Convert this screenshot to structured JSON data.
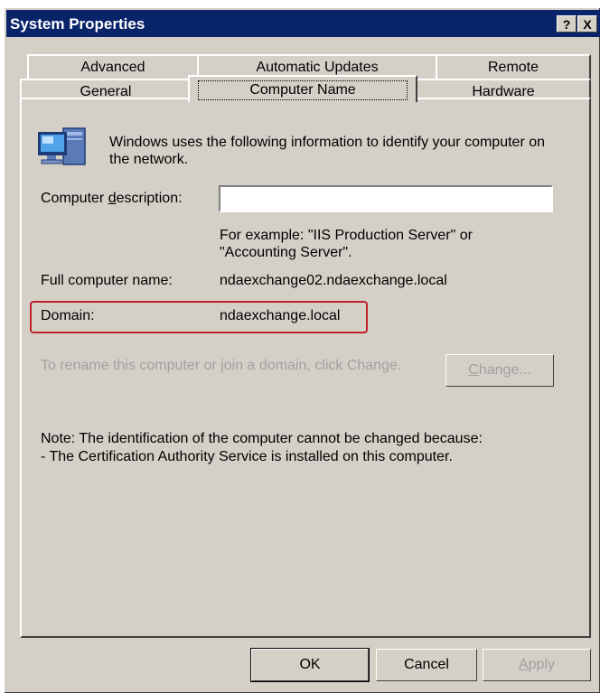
{
  "window": {
    "title": "System Properties",
    "help_button": "?",
    "close_button": "X"
  },
  "tabs": {
    "row1": [
      "Advanced",
      "Automatic Updates",
      "Remote"
    ],
    "row2": [
      "General",
      "Computer Name",
      "Hardware"
    ],
    "active": "Computer Name"
  },
  "content": {
    "intro": "Windows uses the following information to identify your computer on the network.",
    "description_label_pre": "Computer ",
    "description_label_ul": "d",
    "description_label_post": "escription:",
    "description_value": "",
    "example_text": "For example: \"IIS Production Server\" or \"Accounting Server\".",
    "full_name_label": "Full computer name:",
    "full_name_value": "ndaexchange02.ndaexchange.local",
    "domain_label": "Domain:",
    "domain_value": "ndaexchange.local",
    "rename_text": "To rename this computer or join a domain, click Change.",
    "change_button_ul": "C",
    "change_button_rest": "hange...",
    "note_line1": "Note: The identification of the computer cannot be changed because:",
    "note_line2": "- The Certification Authority Service is installed on this computer."
  },
  "footer": {
    "ok": "OK",
    "cancel": "Cancel",
    "apply_ul": "A",
    "apply_rest": "pply"
  },
  "colors": {
    "titlebar": "#0a246a",
    "face": "#d4d0c8",
    "highlight": "#c0202a"
  }
}
